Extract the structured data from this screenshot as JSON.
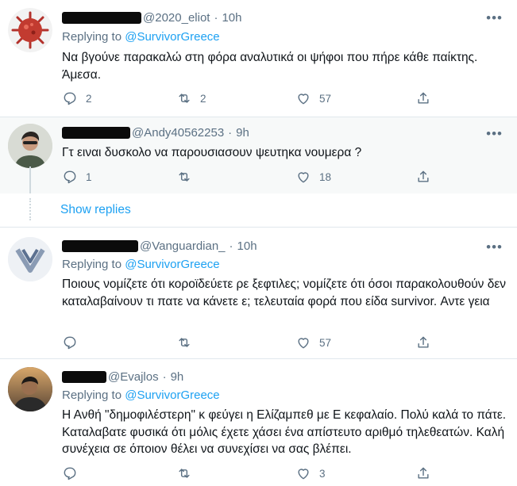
{
  "tweets": [
    {
      "handle": "@2020_eliot",
      "time": "10h",
      "replying_label": "Replying to",
      "replying_to": "@SurvivorGreece",
      "text": "Να βγούνε παρακαλώ στη φόρα αναλυτικά οι ψήφοι που πήρε κάθε παίκτης. Άμεσα.",
      "replies": "2",
      "retweets": "2",
      "likes": "57"
    },
    {
      "handle": "@Andy40562253",
      "time": "9h",
      "text": "Γτ ειναι δυσκολο να παρουσιασουν ψευτηκα νουμερα ?",
      "replies": "1",
      "retweets": "",
      "likes": "18"
    },
    {
      "handle": "@Vanguardian_",
      "time": "10h",
      "replying_label": "Replying to",
      "replying_to": "@SurvivorGreece",
      "text": "Ποιους νομίζετε ότι κοροϊδεύετε ρε ξεφτιλες; νομίζετε ότι όσοι παρακολουθούν δεν καταλαβαίνουν τι πατε να κάνετε ε; τελευταία φορά που είδα survivor. Αντε γεια",
      "replies": "",
      "retweets": "",
      "likes": "57"
    },
    {
      "handle": "@Evajlos",
      "time": "9h",
      "replying_label": "Replying to",
      "replying_to": "@SurvivorGreece",
      "text": "Η Ανθή \"δημοφιλέστερη\" κ φεύγει η Ελίζαμπεθ με Ε κεφαλαίο. Πολύ καλά το πάτε. Καταλαβατε φυσικά ότι μόλις έχετε χάσει ένα απίστευτο αριθμό τηλεθεατών. Καλή συνέχεια σε όποιον θέλει να συνεχίσει να σας βλέπει.",
      "replies": "",
      "retweets": "",
      "likes": "3"
    }
  ],
  "show_replies": "Show replies",
  "icons": {
    "reply": "reply-icon",
    "retweet": "retweet-icon",
    "like": "heart-icon",
    "share": "share-icon",
    "more": "more-icon"
  },
  "colors": {
    "link": "#1da1f2",
    "secondary": "#5b7083",
    "highlight_bg": "#f7f9f9"
  }
}
